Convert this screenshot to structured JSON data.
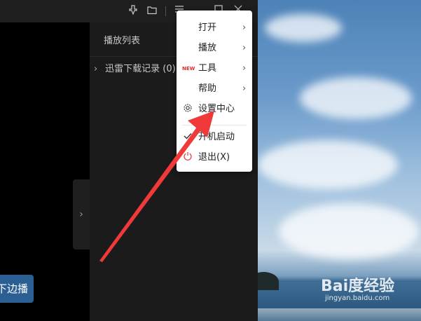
{
  "playlist": {
    "title": "播放列表",
    "items": [
      {
        "label": "迅雷下载记录 (0)"
      }
    ]
  },
  "edge_button": {
    "label": "下边播"
  },
  "menu": {
    "items": [
      {
        "label": "打开",
        "has_submenu": true
      },
      {
        "label": "播放",
        "has_submenu": true
      },
      {
        "label": "工具",
        "has_submenu": true,
        "badge": "NEW"
      },
      {
        "label": "帮助",
        "has_submenu": true
      },
      {
        "label": "设置中心",
        "icon": "gear-icon"
      },
      {
        "label": "开机启动",
        "icon": "checkmark-icon",
        "checked": true
      },
      {
        "label": "退出(X)",
        "icon": "power-icon"
      }
    ]
  },
  "titlebar_icons": [
    "pin-icon",
    "folder-icon",
    "menu-icon",
    "minimize-icon",
    "maximize-icon",
    "close-icon"
  ],
  "watermark": {
    "brand": "Bai度经验",
    "url": "jingyan.baidu.com"
  },
  "colors": {
    "menu_accent": "#e02b2b",
    "annotation_arrow": "#f03a3a",
    "edge_button": "#2b5f94"
  }
}
